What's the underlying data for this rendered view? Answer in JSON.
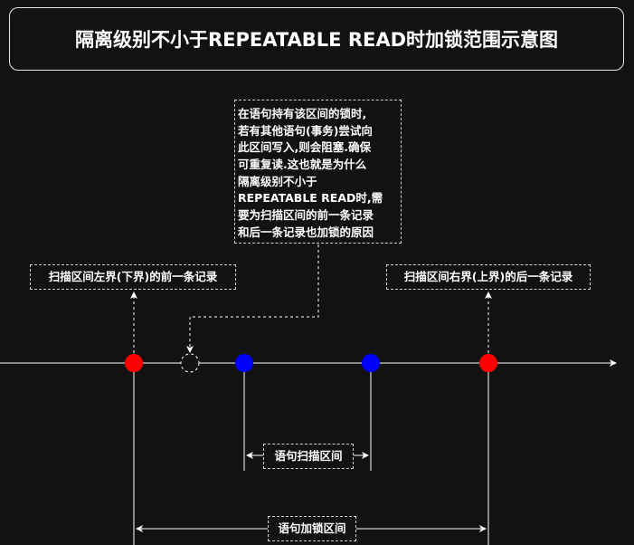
{
  "title": "隔离级别不小于REPEATABLE READ时加锁范围示意图",
  "note_lines": [
    "在语句持有该区间的锁时,",
    "若有其他语句(事务)尝试向",
    "此区间写入,则会阻塞.确保",
    "可重复读.这也就是为什么",
    "隔离级别不小于",
    "REPEATABLE READ时,需",
    "要为扫描区间的前一条记录",
    "和后一条记录也加锁的原因"
  ],
  "left_label": "扫描区间左界(下界)的前一条记录",
  "right_label": "扫描区间右界(上界)的后一条记录",
  "scan_label": "语句扫描区间",
  "lock_label": "语句加锁区间",
  "colors": {
    "boundary_record": "#ff0000",
    "scan_record": "#0000ff",
    "background": "#121212",
    "line": "#ffffff"
  }
}
